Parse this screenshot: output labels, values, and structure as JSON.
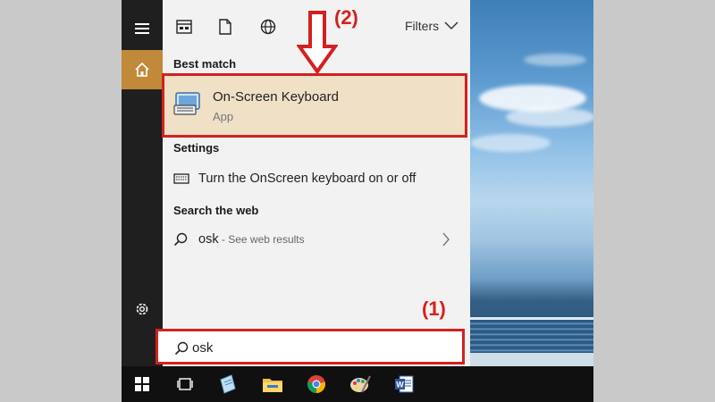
{
  "filters_label": "Filters",
  "best_match": {
    "heading": "Best match",
    "title": "On-Screen Keyboard",
    "subtitle": "App"
  },
  "settings": {
    "heading": "Settings",
    "item": "Turn the OnScreen keyboard on or off"
  },
  "web": {
    "heading": "Search the web",
    "query": "osk",
    "hint": " - See web results"
  },
  "search": {
    "value": "osk"
  },
  "annotations": {
    "step1": "(1)",
    "step2": "(2)"
  },
  "colors": {
    "accent": "#c08a3a",
    "highlight": "#d42020",
    "best_bg": "#f0e0c6"
  },
  "taskbar_icons": [
    "windows-icon",
    "task-view-icon",
    "notepad-icon",
    "file-explorer-icon",
    "chrome-icon",
    "paint-icon",
    "word-icon"
  ]
}
